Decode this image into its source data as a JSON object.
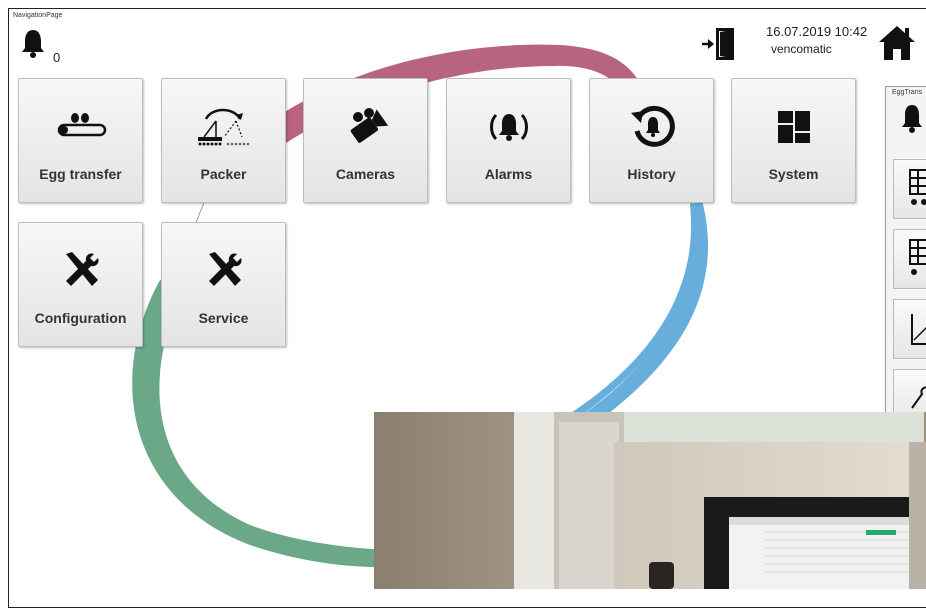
{
  "page": {
    "label": "NavigationPage",
    "alarm_count": "0",
    "datetime": "16.07.2019 10:42",
    "user": "vencomatic"
  },
  "tiles": [
    {
      "label": "Egg transfer",
      "icon": "egg-conveyor-icon"
    },
    {
      "label": "Packer",
      "icon": "packer-icon"
    },
    {
      "label": "Cameras",
      "icon": "camera-icon"
    },
    {
      "label": "Alarms",
      "icon": "alarm-bell-icon"
    },
    {
      "label": "History",
      "icon": "history-icon"
    },
    {
      "label": "System",
      "icon": "system-grid-icon"
    },
    {
      "label": "Configuration",
      "icon": "tools-icon"
    },
    {
      "label": "Service",
      "icon": "tools-icon"
    }
  ],
  "right_panel": {
    "label": "EggTrans"
  },
  "colors": {
    "swirl_pink": "#b8637f",
    "swirl_blue": "#67aedc",
    "swirl_green": "#6aa888",
    "icon": "#111111"
  }
}
